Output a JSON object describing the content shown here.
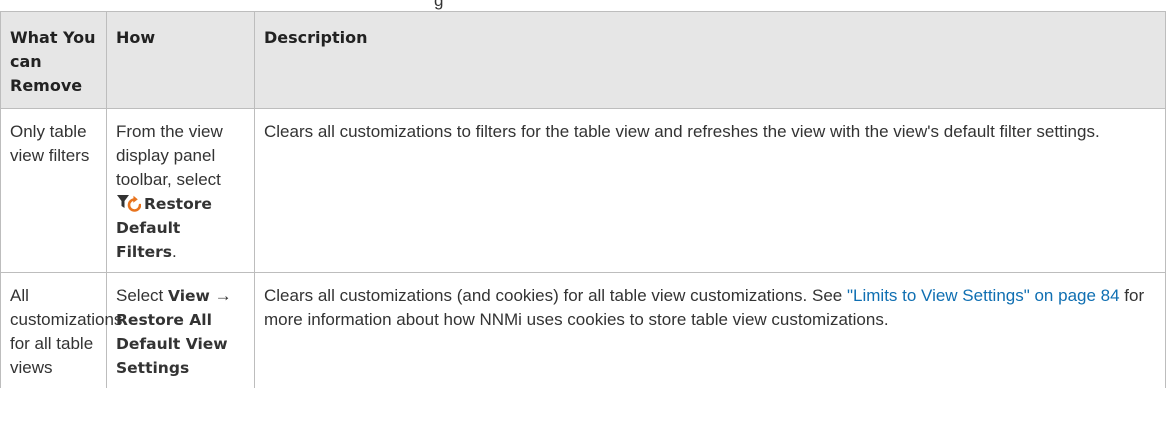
{
  "clipped_top_text": "g",
  "table": {
    "headers": [
      "What You can Remove",
      "How",
      "Description"
    ],
    "rows": [
      {
        "what": "Only table view filters",
        "how": {
          "prefix": "From the view display panel toolbar, select ",
          "icon": "restore-default-filters-icon",
          "action": "Restore Default Filters",
          "suffix": "."
        },
        "description": {
          "text": "Clears all customizations to filters for the table view and refreshes the view with the view's default filter settings."
        }
      },
      {
        "what": "All customizations for all table views",
        "how": {
          "prefix": "Select ",
          "menu": "View",
          "arrow": " → ",
          "action": "Restore All Default View Settings"
        },
        "description": {
          "before": "Clears all customizations (and cookies) for all table view customizations. See ",
          "link": "\"Limits to View Settings\" on page 84",
          "after": " for more information about how NNMi uses cookies to store table view customizations."
        }
      }
    ]
  },
  "colors": {
    "header_bg": "#e6e6e6",
    "border": "#bdbdbd",
    "link": "#0f6fb2",
    "text": "#333333"
  }
}
